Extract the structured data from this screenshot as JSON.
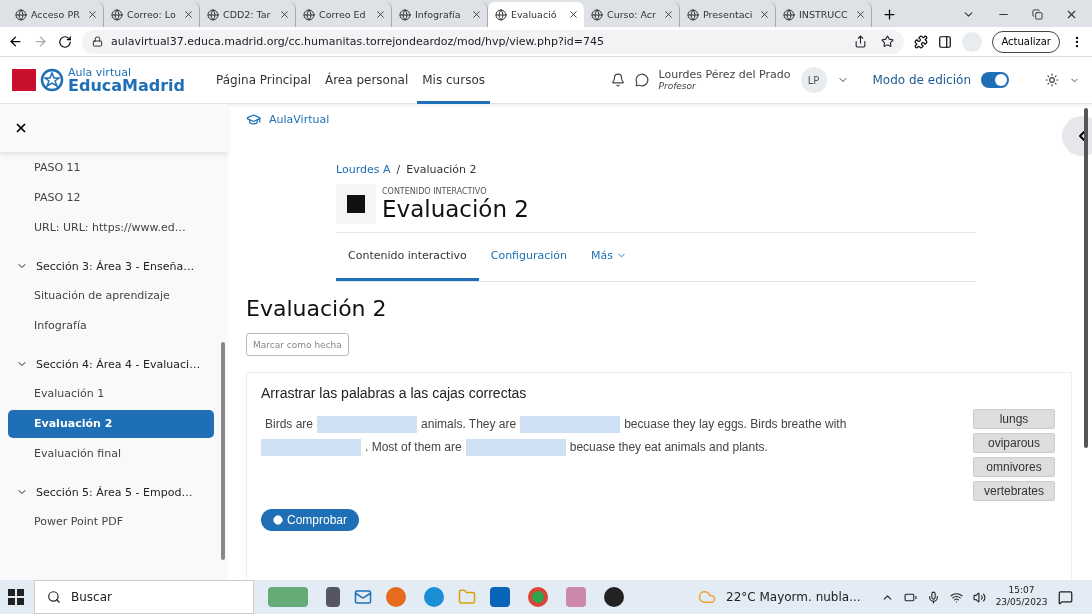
{
  "browser": {
    "tabs": [
      {
        "title": "Acceso PR",
        "selected": false
      },
      {
        "title": "Correo: Lo",
        "selected": false
      },
      {
        "title": "CDD2: Tar",
        "selected": false
      },
      {
        "title": "Correo Ed",
        "selected": false
      },
      {
        "title": "Infografía",
        "selected": false
      },
      {
        "title": "Evaluació",
        "selected": true
      },
      {
        "title": "Curso: Acr",
        "selected": false
      },
      {
        "title": "Presentaci",
        "selected": false
      },
      {
        "title": "INSTRUCC",
        "selected": false
      }
    ],
    "address": "aulavirtual37.educa.madrid.org/cc.humanitas.torrejondeardoz/mod/hvp/view.php?id=745",
    "update_button": "Actualizar"
  },
  "site": {
    "logo_small": "Aula virtual",
    "logo_big": "EducaMadrid",
    "nav": [
      {
        "label": "Página Principal",
        "selected": false
      },
      {
        "label": "Área personal",
        "selected": false
      },
      {
        "label": "Mis cursos",
        "selected": true
      }
    ],
    "user": {
      "name": "Lourdes Pérez del Prado",
      "role": "Profesor",
      "initials": "LP"
    },
    "edit_mode": {
      "label": "Modo de edición",
      "on": true
    }
  },
  "sidebar": {
    "items": [
      {
        "kind": "item",
        "label": "PASO 11",
        "selected": false
      },
      {
        "kind": "item",
        "label": "PASO 12",
        "selected": false
      },
      {
        "kind": "item",
        "label": "URL: URL: https://www.ed…",
        "selected": false
      },
      {
        "kind": "section",
        "label": "Sección 3: Área 3 - Enseña…",
        "expanded": true,
        "children": [
          {
            "kind": "item",
            "label": "Situación de aprendizaje",
            "selected": false
          },
          {
            "kind": "item",
            "label": "Infografía",
            "selected": false
          }
        ]
      },
      {
        "kind": "section",
        "label": "Sección 4: Área 4 - Evaluaci…",
        "expanded": true,
        "children": [
          {
            "kind": "item",
            "label": "Evaluación 1",
            "selected": false
          },
          {
            "kind": "item",
            "label": "Evaluación 2",
            "selected": true
          },
          {
            "kind": "item",
            "label": "Evaluación final",
            "selected": false
          }
        ]
      },
      {
        "kind": "section",
        "label": "Sección 5: Área 5 - Empod…",
        "expanded": true,
        "children": [
          {
            "kind": "item",
            "label": "Power Point PDF",
            "selected": false
          }
        ]
      }
    ]
  },
  "page": {
    "site_link": "AulaVirtual",
    "breadcrumb": [
      {
        "label": "Lourdes A",
        "kind": "link"
      },
      {
        "label": "/",
        "kind": "separator"
      },
      {
        "label": "Evaluación 2",
        "kind": "current"
      }
    ],
    "kicker": "CONTENIDO INTERACTIVO",
    "title": "Evaluación 2",
    "tabs": [
      {
        "label": "Contenido interactivo",
        "selected": true,
        "caret": false
      },
      {
        "label": "Configuración",
        "selected": false,
        "caret": false
      },
      {
        "label": "Más",
        "selected": false,
        "caret": true
      }
    ],
    "heading": "Evaluación 2",
    "mark_button": "Marcar como hecha",
    "activity": {
      "instruction": "Arrastrar las palabras a las cajas correctas",
      "segments": [
        {
          "kind": "text",
          "text": "Birds are"
        },
        {
          "kind": "blank"
        },
        {
          "kind": "text",
          "text": "animals. They are"
        },
        {
          "kind": "blank"
        },
        {
          "kind": "text",
          "text": "becuase they lay eggs. Birds breathe with"
        },
        {
          "kind": "blank"
        },
        {
          "kind": "text",
          "text": ". Most of them are"
        },
        {
          "kind": "blank"
        },
        {
          "kind": "text",
          "text": "becuase they eat animals and plants."
        }
      ],
      "words": [
        "lungs",
        "oviparous",
        "omnivores",
        "vertebrates"
      ],
      "check_button": "Comprobar"
    }
  },
  "taskbar": {
    "search": "Buscar",
    "weather": "22°C  Mayorm. nubla...",
    "time": "15:07",
    "date": "23/05/2023"
  }
}
